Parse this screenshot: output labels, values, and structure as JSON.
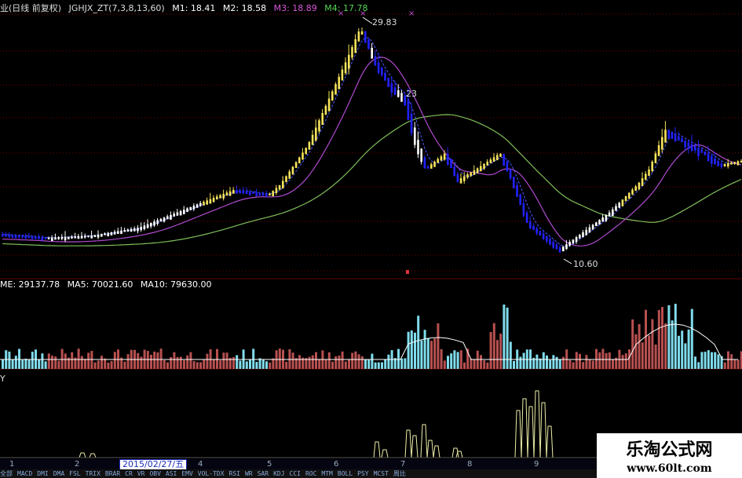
{
  "main_legend": {
    "title": "业(日线 前复权)",
    "indicator": "JGHJX_ZT(7,3,8,13,60)",
    "m1": "M1: 18.41",
    "m2": "M2: 18.58",
    "m3": "M3: 18.89",
    "m4": "M4: 17.78"
  },
  "price_annotations": {
    "high": "29.83",
    "low": "10.60",
    "mid": "23"
  },
  "volume_legend": {
    "vol": "ME: 29137.78",
    "ma5": "MA5: 70021.60",
    "ma10": "MA10: 79630.00"
  },
  "indicator_legend": {
    "label": "Y"
  },
  "time_axis": {
    "marks": [
      "1",
      "2",
      "4",
      "5",
      "6",
      "7",
      "8",
      "9"
    ],
    "date": "2015/02/27/五"
  },
  "tabs": [
    "全部",
    "MACD",
    "DMI",
    "DMA",
    "FSL",
    "TRIX",
    "BRAR",
    "CR",
    "VR",
    "OBV",
    "ASI",
    "EMV",
    "VOL-TDX",
    "RSI",
    "WR",
    "SAR",
    "KDJ",
    "CCI",
    "ROC",
    "MTM",
    "BOLL",
    "PSY",
    "MCST",
    "周比"
  ],
  "watermark": {
    "name": "乐淘公式网",
    "url": "www.60lt.com"
  },
  "colors": {
    "background": "#000000",
    "up": "#ffffff",
    "down": "#2222ff",
    "yellow_up": "#f5e35a",
    "ma_green": "#7fbf5a",
    "ma_purple": "#b04ad0",
    "m3": "#d957d9",
    "m4": "#55d455",
    "vol_up": "#b85050",
    "vol_down": "#7fdcec",
    "grid": "#800000",
    "indicator": "#eeeeaa"
  }
}
